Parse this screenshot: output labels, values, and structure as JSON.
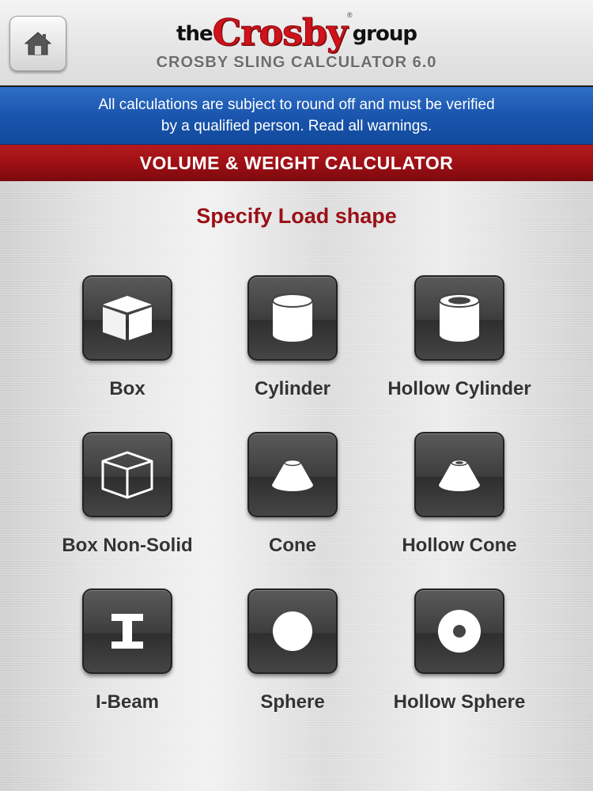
{
  "header": {
    "logo_prefix": "the",
    "logo_main": "Crosby",
    "logo_suffix": "group",
    "logo_mark": "®",
    "app_title": "CROSBY SLING CALCULATOR 6.0",
    "home_icon": "home-icon"
  },
  "notice": {
    "line1": "All calculations are subject to round off and must be verified",
    "line2": "by a qualified person. Read all warnings."
  },
  "section_title": "VOLUME & WEIGHT CALCULATOR",
  "prompt": "Specify Load shape",
  "shapes": [
    {
      "label": "Box",
      "icon": "box-icon"
    },
    {
      "label": "Cylinder",
      "icon": "cylinder-icon"
    },
    {
      "label": "Hollow Cylinder",
      "icon": "hollow-cylinder-icon"
    },
    {
      "label": "Box Non-Solid",
      "icon": "box-non-solid-icon"
    },
    {
      "label": "Cone",
      "icon": "cone-icon"
    },
    {
      "label": "Hollow Cone",
      "icon": "hollow-cone-icon"
    },
    {
      "label": "I-Beam",
      "icon": "i-beam-icon"
    },
    {
      "label": "Sphere",
      "icon": "sphere-icon"
    },
    {
      "label": "Hollow Sphere",
      "icon": "hollow-sphere-icon"
    }
  ],
  "colors": {
    "brand_red": "#d0121b",
    "notice_blue": "#1a55ae",
    "section_red": "#9c0f14",
    "prompt_red": "#9a1016",
    "tile_dark": "#3d3d3d"
  }
}
